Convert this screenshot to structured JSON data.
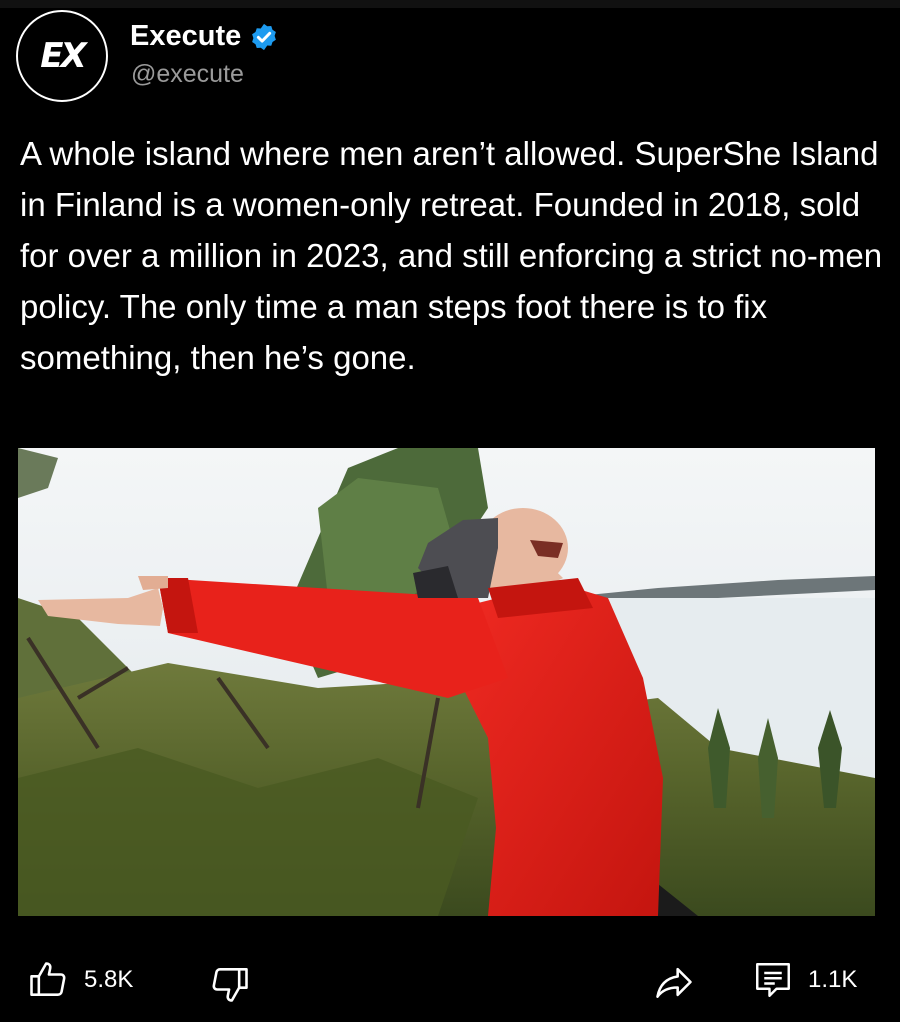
{
  "post": {
    "avatar_text": "EX",
    "display_name": "Execute",
    "handle": "@execute",
    "text": "A whole island where men aren’t allowed. SuperShe Island in Finland is a women-only retreat. Founded in 2018, sold for over a million in 2023, and still enforcing a strict no-men policy. The only time a man steps foot there is to fix something, then he’s gone."
  },
  "actions": {
    "like_count": "5.8K",
    "comment_count": "1.1K"
  },
  "colors": {
    "background": "#000000",
    "verified_badge": "#1d9bf0",
    "handle_gray": "#9a9a9a",
    "jacket_red": "#e01e1e"
  },
  "icons": [
    "thumbs-up-icon",
    "thumbs-down-icon",
    "share-icon",
    "comment-icon",
    "verified-badge-icon"
  ]
}
